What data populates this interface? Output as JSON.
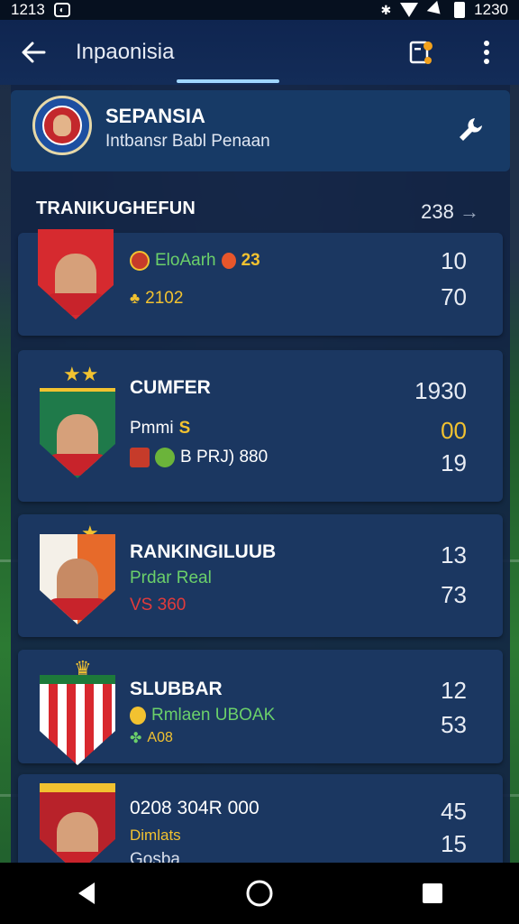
{
  "status_bar": {
    "time_left": "1213",
    "time_right": "1230"
  },
  "app_bar": {
    "title": "Inpaonisia"
  },
  "header_card": {
    "title": "SEPANSIA",
    "subtitle": "Intbansr Babl Penaan"
  },
  "section": {
    "title": "TRANIKUGHEFUN",
    "count": "238",
    "arrow": "→"
  },
  "cards": [
    {
      "title": "",
      "line1": "EloAarh",
      "line1_badge": "23",
      "line2": "2102",
      "value1": "10",
      "value2": "70"
    },
    {
      "title": "CUMFER",
      "line1": "Pmmi",
      "line1_badge": "S",
      "line2": "B PRJ) 880",
      "value_top": "1930",
      "value1": "00",
      "value2": "19"
    },
    {
      "title": "RANKINGILUUB",
      "line1": "Prdar Real",
      "line2": "VS 360",
      "value1": "13",
      "value2": "73"
    },
    {
      "title": "SLUBBAR",
      "line1": "Rmlaen UBOAK",
      "line2": "A08",
      "value1": "12",
      "value2": "53"
    },
    {
      "title": "0208 304R 000",
      "line1": "Dimlats",
      "line2": "Gosba",
      "value1": "45",
      "value2": "15"
    }
  ],
  "colors": {
    "panel": "#122444",
    "card": "#1b3761",
    "gold": "#f2c230",
    "green": "#6bd06a",
    "red": "#e23b3b"
  }
}
